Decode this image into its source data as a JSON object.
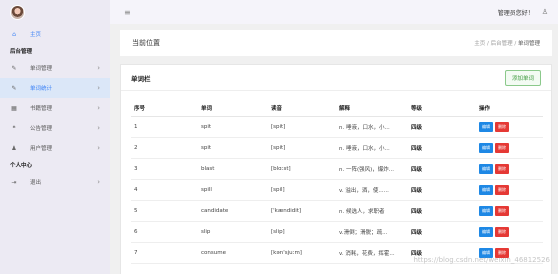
{
  "sidebar": {
    "home": {
      "label": "主页",
      "icon": "home-icon"
    },
    "section_admin": "后台管理",
    "items": [
      {
        "label": "单词管理",
        "icon": "edit-icon"
      },
      {
        "label": "单词统计",
        "icon": "edit-icon"
      },
      {
        "label": "书籍管理",
        "icon": "book-icon"
      },
      {
        "label": "公告管理",
        "icon": "quote-icon"
      },
      {
        "label": "用户管理",
        "icon": "user-icon"
      }
    ],
    "section_personal": "个人中心",
    "logout": {
      "label": "退出",
      "icon": "logout-icon"
    }
  },
  "topbar": {
    "menu_glyph": "≡",
    "admin_greeting": "管理员您好！",
    "user_glyph": "♙"
  },
  "breadcrumb": {
    "title": "当前位置",
    "path": [
      "主页",
      "后台管理",
      "单词管理"
    ]
  },
  "panel": {
    "title": "单词栏",
    "add_button": "添加单词"
  },
  "table": {
    "headers": [
      "序号",
      "单词",
      "读音",
      "解释",
      "等级",
      "操作"
    ],
    "edit_label": "编辑",
    "delete_label": "删除",
    "rows": [
      {
        "id": "1",
        "word": "spit",
        "phonetic": "[spit]",
        "meaning": "n. 唾液，口水，小...",
        "level": "四级"
      },
      {
        "id": "2",
        "word": "spit",
        "phonetic": "[spit]",
        "meaning": "n. 唾液，口水，小...",
        "level": "四级"
      },
      {
        "id": "3",
        "word": "blast",
        "phonetic": "[blɑːst]",
        "meaning": "n. 一阵(强风)，爆炸...",
        "level": "四级"
      },
      {
        "id": "4",
        "word": "spill",
        "phonetic": "[spil]",
        "meaning": "v. 溢出，洒，使......",
        "level": "四级"
      },
      {
        "id": "5",
        "word": "candidate",
        "phonetic": "['kændidit]",
        "meaning": "n. 候选人，求职者",
        "level": "四级"
      },
      {
        "id": "6",
        "word": "slip",
        "phonetic": "[slip]",
        "meaning": "v.滑倒；滑脱；疏...",
        "level": "四级"
      },
      {
        "id": "7",
        "word": "consume",
        "phonetic": "[kən'sjuːm]",
        "meaning": "v. 消耗，花费，挥霍...",
        "level": "四级"
      }
    ]
  },
  "watermark": "https://blog.csdn.net/weixin_46812526",
  "colors": {
    "accent": "#3b82f6",
    "edit": "#1e88e5",
    "delete": "#e53935",
    "add": "#3c9a3c"
  }
}
